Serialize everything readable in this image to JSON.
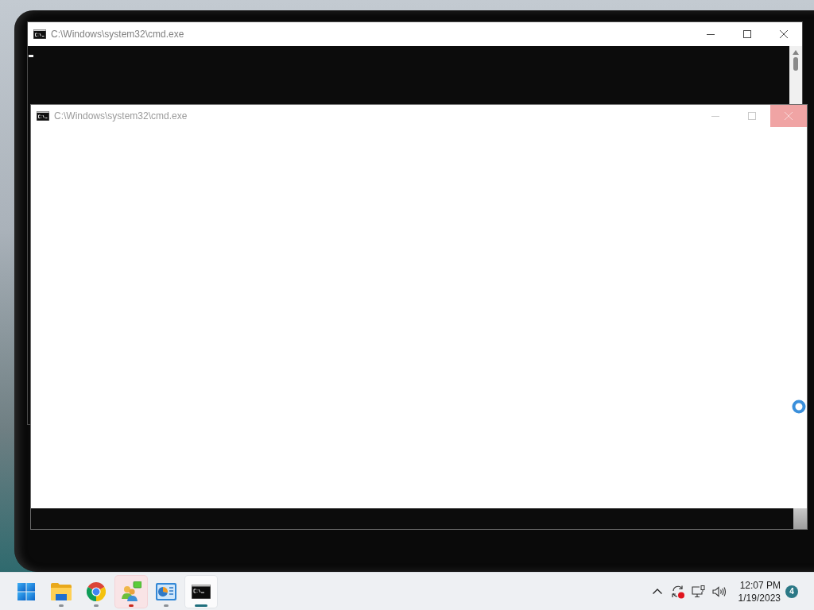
{
  "windows": [
    {
      "kind": "console",
      "title": "C:\\Windows\\system32\\cmd.exe",
      "cursor": true,
      "close_highlighted": false
    },
    {
      "kind": "not-responding",
      "title": "C:\\Windows\\system32\\cmd.exe",
      "close_highlighted": true
    }
  ],
  "taskbar": {
    "apps": [
      {
        "kind": "start",
        "selected": false
      },
      {
        "kind": "folder",
        "running": true,
        "attention": false,
        "selected": false
      },
      {
        "kind": "browser",
        "running": true,
        "attention": false,
        "selected": false
      },
      {
        "kind": "messenger",
        "running": true,
        "attention": true,
        "selected": false
      },
      {
        "kind": "control-panel",
        "running": true,
        "attention": false,
        "selected": false
      },
      {
        "kind": "console",
        "running": true,
        "attention": false,
        "selected": true
      }
    ],
    "clock": {
      "time": "12:07 PM",
      "date": "1/19/2023"
    },
    "notification_count": "4"
  }
}
